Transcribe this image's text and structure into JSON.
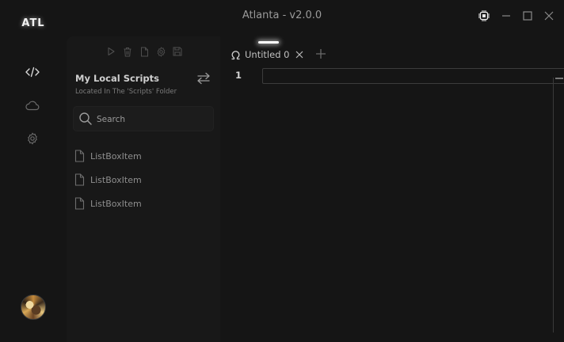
{
  "app": {
    "logo_text": "ATL",
    "window_title": "Atlanta - v2.0.0"
  },
  "window_controls": [
    "cpu-icon",
    "minimize-icon",
    "maximize-icon",
    "close-icon"
  ],
  "sidebar": {
    "items": [
      {
        "icon": "code-icon",
        "active": true
      },
      {
        "icon": "cloud-icon",
        "active": false
      },
      {
        "icon": "gear-icon",
        "active": false
      }
    ],
    "avatar": "user-avatar"
  },
  "scripts_panel": {
    "toolbar": [
      "play-icon",
      "trash-icon",
      "file-icon",
      "settings-icon",
      "save-icon"
    ],
    "title": "My Local Scripts",
    "subtitle": "Located In The 'Scripts' Folder",
    "search_placeholder": "Search",
    "items": [
      {
        "label": "ListBoxItem"
      },
      {
        "label": "ListBoxItem"
      },
      {
        "label": "ListBoxItem"
      }
    ]
  },
  "editor": {
    "tabs": [
      {
        "label": "Untitled 0",
        "icon": "omega-icon"
      }
    ],
    "line_numbers": [
      "1"
    ],
    "content": ""
  },
  "colors": {
    "background": "#151515",
    "panel": "#181818",
    "text": "#c8c8c8",
    "muted": "#8e8e8e",
    "accent": "#ffffff"
  }
}
